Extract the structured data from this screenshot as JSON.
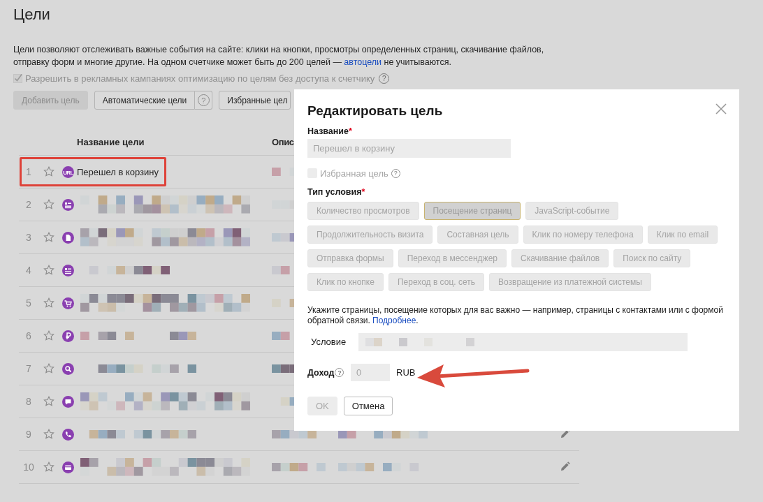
{
  "page_title": "Цели",
  "intro": {
    "text": "Цели позволяют отслеживать важные события на сайте: клики на кнопки, просмотры определенных страниц, скачивание файлов, отправку форм и многие другие. На одном счетчике может быть до 200 целей — ",
    "link": "автоцели",
    "text_after": " не учитываются."
  },
  "ad_option": {
    "label": "Разрешить в рекламных кампаниях оптимизацию по целям без доступа к счетчику",
    "checked": true,
    "disabled": true,
    "help": "?"
  },
  "toolbar": [
    {
      "label": "Добавить цель",
      "disabled": true
    },
    {
      "label": "Автоматические цели",
      "disabled": false,
      "help": "?"
    },
    {
      "label": "Избранные цел",
      "disabled": false
    }
  ],
  "table": {
    "columns": [
      "Название цели",
      "Опис"
    ],
    "rows": [
      {
        "number": "1",
        "favorite": false,
        "kind": "url",
        "badge": "URL",
        "name": "Перешел в корзину",
        "highlighted": true,
        "editable": false
      },
      {
        "number": "2",
        "favorite": false,
        "kind": "form",
        "highlighted": false,
        "editable": false
      },
      {
        "number": "3",
        "favorite": false,
        "kind": "file",
        "highlighted": false,
        "editable": false
      },
      {
        "number": "4",
        "favorite": false,
        "kind": "form",
        "highlighted": false,
        "editable": false
      },
      {
        "number": "5",
        "favorite": false,
        "kind": "cart",
        "highlighted": false,
        "editable": false
      },
      {
        "number": "6",
        "favorite": false,
        "kind": "ruble",
        "highlighted": false,
        "editable": false
      },
      {
        "number": "7",
        "favorite": false,
        "kind": "search",
        "highlighted": false,
        "editable": false
      },
      {
        "number": "8",
        "favorite": false,
        "kind": "chat",
        "highlighted": false,
        "editable": false
      },
      {
        "number": "9",
        "favorite": false,
        "kind": "phone",
        "highlighted": false,
        "editable": true
      },
      {
        "number": "10",
        "favorite": false,
        "kind": "payment",
        "highlighted": false,
        "editable": true
      }
    ]
  },
  "dialog": {
    "title": "Редактировать цель",
    "name_field": {
      "label": "Название",
      "required_mark": "*",
      "value": "Перешел в корзину",
      "disabled": true
    },
    "favorite": {
      "label": "Избранная цель",
      "checked": false,
      "disabled": true,
      "help": "?"
    },
    "condition_type": {
      "label": "Тип условия",
      "required_mark": "*",
      "option_rows": [
        [
          {
            "label": "Количество просмотров",
            "selected": false
          },
          {
            "label": "Посещение страниц",
            "selected": true
          },
          {
            "label": "JavaScript-событие",
            "selected": false
          }
        ],
        [
          {
            "label": "Продолжительность визита",
            "selected": false
          },
          {
            "label": "Составная цель",
            "selected": false
          },
          {
            "label": "Клик по номеру телефона",
            "selected": false
          },
          {
            "label": "Клик по email",
            "selected": false
          }
        ],
        [
          {
            "label": "Отправка формы",
            "selected": false
          },
          {
            "label": "Переход в мессенджер",
            "selected": false
          },
          {
            "label": "Скачивание файлов",
            "selected": false
          },
          {
            "label": "Поиск по сайту",
            "selected": false
          }
        ],
        [
          {
            "label": "Клик по кнопке",
            "selected": false
          },
          {
            "label": "Переход в соц. сеть",
            "selected": false
          },
          {
            "label": "Возвращение из платежной системы",
            "selected": false
          }
        ]
      ]
    },
    "hint": {
      "text": "Укажите страницы, посещение которых для вас важно — например, страницы с контактами или с формой обратной связи. ",
      "link": "Подробнее",
      "text_after": "."
    },
    "condition": {
      "label": "Условие"
    },
    "income": {
      "label": "Доход",
      "help": "?",
      "value": "0",
      "currency": "RUB"
    },
    "buttons": [
      {
        "label": "OK",
        "kind": "primary",
        "disabled": true
      },
      {
        "label": "Отмена",
        "kind": "secondary",
        "disabled": false
      }
    ]
  }
}
